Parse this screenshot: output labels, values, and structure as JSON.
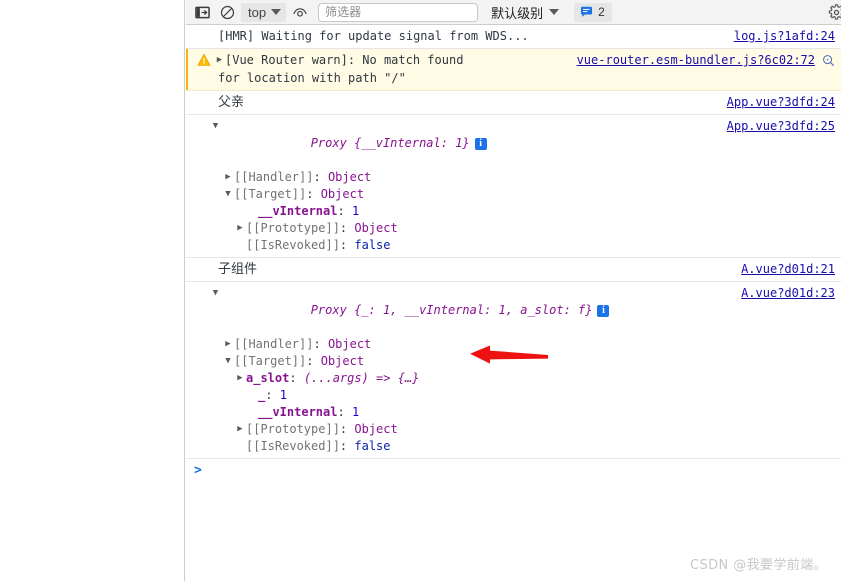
{
  "toolbar": {
    "sidebar_toggle_icon": "console-sidebar-icon",
    "clear_console_icon": "clear-console-icon",
    "context_selector": {
      "label": "top",
      "caret_icon": "chevron-down-icon"
    },
    "live_expression_icon": "eye-icon",
    "filter": {
      "value": "",
      "placeholder": "筛选器"
    },
    "level_selector": {
      "label": "默认级别",
      "caret_icon": "chevron-down-icon"
    },
    "issues": {
      "icon": "message-bubble-icon",
      "count": "2"
    },
    "settings_icon": "gear-icon"
  },
  "console": {
    "messages": [
      {
        "type": "log",
        "text": "[HMR] Waiting for update signal from WDS...",
        "source": "log.js?1afd:24"
      },
      {
        "type": "warning",
        "warn_icon": "warning-triangle-icon",
        "disclosure_icon": "triangle-right-icon",
        "line1": "[Vue Router warn]: No match found",
        "line2": "for location with path \"/\"",
        "source": "vue-router.esm-bundler.js?6c02:72",
        "magnifier_icon": "search-icon"
      },
      {
        "type": "log",
        "text": "父亲",
        "source": "App.vue?3dfd:24"
      },
      {
        "type": "object",
        "source": "App.vue?3dfd:25",
        "header": {
          "twisty": "▼",
          "name": "Proxy",
          "preview": "{__vInternal: 1}",
          "info_badge": "i"
        },
        "tree": [
          {
            "twisty": "▶",
            "indent": 0,
            "key": "[[Handler]]",
            "sep": ": ",
            "value": "Object",
            "key_class": "k-internal",
            "value_class": "v-obj"
          },
          {
            "twisty": "▼",
            "indent": 0,
            "key": "[[Target]]",
            "sep": ": ",
            "value": "Object",
            "key_class": "k-internal",
            "value_class": "v-obj"
          },
          {
            "twisty": "",
            "indent": 1,
            "key": "__vInternal",
            "sep": ": ",
            "value": "1",
            "key_class": "k-prop",
            "value_class": "v-num"
          },
          {
            "twisty": "▶",
            "indent": 1,
            "key": "[[Prototype]]",
            "sep": ": ",
            "value": "Object",
            "key_class": "k-internal",
            "value_class": "v-obj"
          },
          {
            "twisty": "",
            "indent": 1,
            "key": "[[IsRevoked]]",
            "sep": ": ",
            "value": "false",
            "key_class": "k-internal",
            "value_class": "v-bool"
          }
        ]
      },
      {
        "type": "log",
        "text": "子组件",
        "source": "A.vue?d01d:21"
      },
      {
        "type": "object",
        "source": "A.vue?d01d:23",
        "header": {
          "twisty": "▼",
          "name": "Proxy",
          "preview": "{_: 1, __vInternal: 1, a_slot: f}",
          "info_badge": "i"
        },
        "tree": [
          {
            "twisty": "▶",
            "indent": 0,
            "key": "[[Handler]]",
            "sep": ": ",
            "value": "Object",
            "key_class": "k-internal",
            "value_class": "v-obj"
          },
          {
            "twisty": "▼",
            "indent": 0,
            "key": "[[Target]]",
            "sep": ": ",
            "value": "Object",
            "key_class": "k-internal",
            "value_class": "v-obj"
          },
          {
            "twisty": "▶",
            "indent": 1,
            "key": "a_slot",
            "sep": ": ",
            "value": "(...args) => {…}",
            "key_class": "k-prop",
            "value_class": "v-fn"
          },
          {
            "twisty": "",
            "indent": 1,
            "key": "_",
            "sep": ": ",
            "value": "1",
            "key_class": "k-prop",
            "value_class": "v-num"
          },
          {
            "twisty": "",
            "indent": 1,
            "key": "__vInternal",
            "sep": ": ",
            "value": "1",
            "key_class": "k-prop",
            "value_class": "v-num"
          },
          {
            "twisty": "▶",
            "indent": 1,
            "key": "[[Prototype]]",
            "sep": ": ",
            "value": "Object",
            "key_class": "k-internal",
            "value_class": "v-obj"
          },
          {
            "twisty": "",
            "indent": 1,
            "key": "[[IsRevoked]]",
            "sep": ": ",
            "value": "false",
            "key_class": "k-internal",
            "value_class": "v-bool"
          }
        ]
      }
    ],
    "prompt_caret": ">"
  },
  "annotation": {
    "arrow_icon": "red-left-arrow",
    "color": "#ee1111"
  },
  "watermark": {
    "text": "CSDN @我要学前端。"
  },
  "colors": {
    "link": "#1a0dab",
    "warning_bg": "#fffbe5",
    "warning_accent": "#f5b400",
    "property_key": "#881391",
    "number": "#1c00cf",
    "accent_blue": "#1a73e8"
  }
}
